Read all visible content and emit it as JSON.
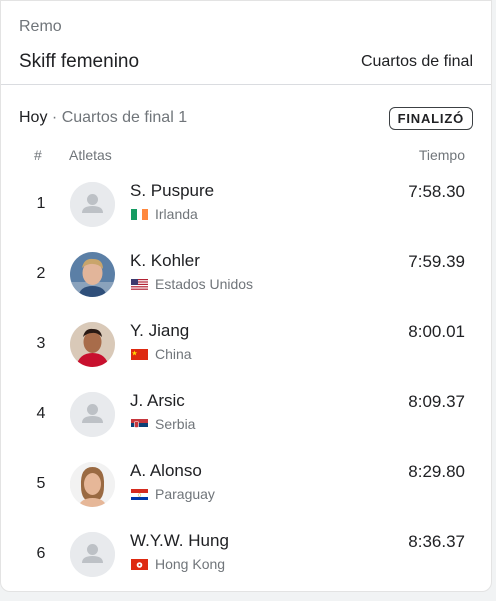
{
  "header": {
    "sport": "Remo",
    "event": "Skiff femenino",
    "round": "Cuartos de final"
  },
  "subheader": {
    "day": "Hoy",
    "separator": "·",
    "heat": "Cuartos de final 1",
    "status_badge": "FINALIZÓ"
  },
  "columns": {
    "rank": "#",
    "athletes": "Atletas",
    "time": "Tiempo"
  },
  "results": [
    {
      "rank": "1",
      "name": "S. Puspure",
      "country": "Irlanda",
      "time": "7:58.30",
      "flag": "ireland-flag-icon",
      "avatar": "placeholder"
    },
    {
      "rank": "2",
      "name": "K. Kohler",
      "country": "Estados Unidos",
      "time": "7:59.39",
      "flag": "usa-flag-icon",
      "avatar": "photo"
    },
    {
      "rank": "3",
      "name": "Y. Jiang",
      "country": "China",
      "time": "8:00.01",
      "flag": "china-flag-icon",
      "avatar": "photo"
    },
    {
      "rank": "4",
      "name": "J. Arsic",
      "country": "Serbia",
      "time": "8:09.37",
      "flag": "serbia-flag-icon",
      "avatar": "placeholder"
    },
    {
      "rank": "5",
      "name": "A. Alonso",
      "country": "Paraguay",
      "time": "8:29.80",
      "flag": "paraguay-flag-icon",
      "avatar": "photo"
    },
    {
      "rank": "6",
      "name": "W.Y.W. Hung",
      "country": "Hong Kong",
      "time": "8:36.37",
      "flag": "hong-kong-flag-icon",
      "avatar": "placeholder"
    }
  ]
}
